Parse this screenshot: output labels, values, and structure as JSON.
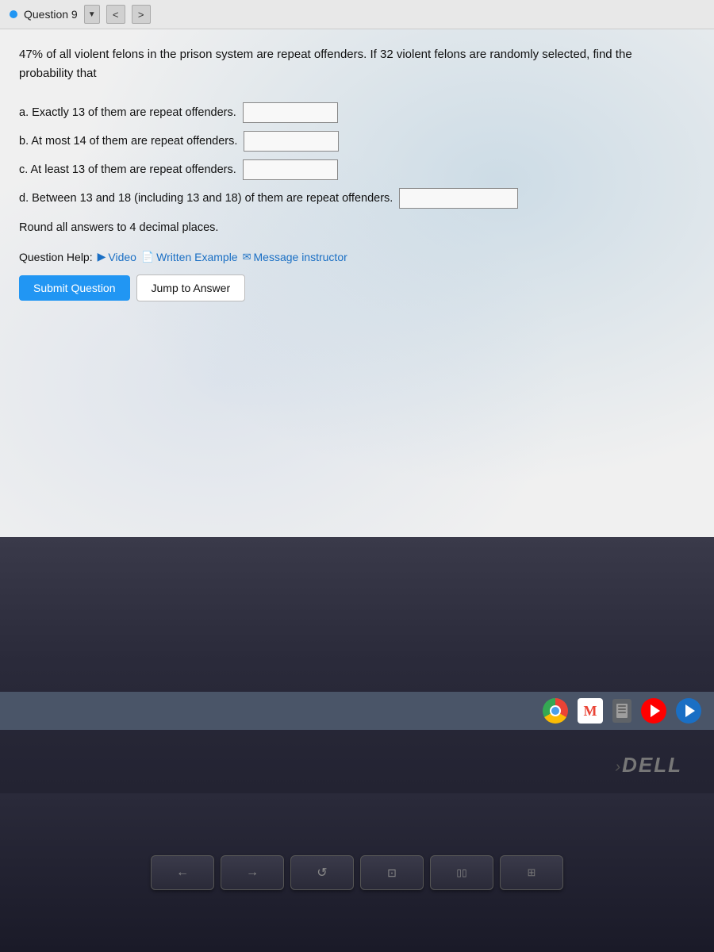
{
  "header": {
    "question_label": "Question 9",
    "bullet_color": "#2196F3",
    "nav_prev": "<",
    "nav_next": ">",
    "dropdown": "▼"
  },
  "question": {
    "text": "47% of all violent felons in the prison system are repeat offenders. If 32 violent felons are randomly selected, find the probability that",
    "parts": [
      {
        "label": "a.",
        "text": "Exactly 13 of them are repeat offenders."
      },
      {
        "label": "b.",
        "text": "At most 14 of them are repeat offenders."
      },
      {
        "label": "c.",
        "text": "At least 13 of them are repeat offenders."
      },
      {
        "label": "d.",
        "text": "Between 13 and 18 (including 13 and 18) of them are repeat offenders."
      }
    ],
    "round_note": "Round all answers to 4 decimal places.",
    "help": {
      "label": "Question Help:",
      "video": "Video",
      "written_example": "Written Example",
      "message_instructor": "Message instructor"
    },
    "buttons": {
      "submit": "Submit Question",
      "jump": "Jump to Answer"
    }
  },
  "taskbar": {
    "icons": [
      "chrome",
      "gmail",
      "files",
      "youtube",
      "play"
    ]
  },
  "dell": {
    "logo": "DELL"
  },
  "keyboard": {
    "keys": [
      "←",
      "→",
      "C",
      "⊡",
      "▯▯"
    ]
  }
}
